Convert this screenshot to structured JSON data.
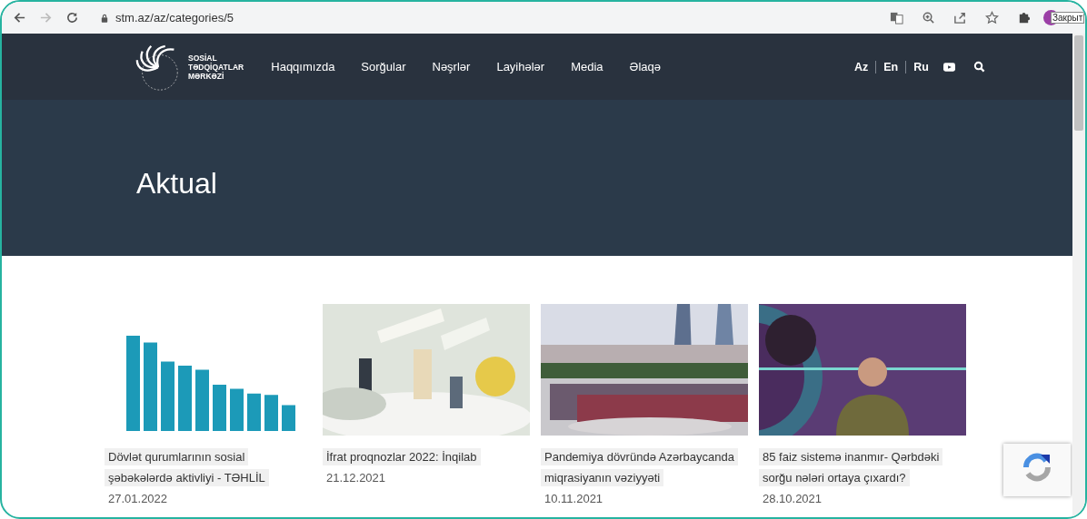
{
  "browser": {
    "url": "stm.az/az/categories/5",
    "tooltip": "Закрыт"
  },
  "header": {
    "logo_lines": [
      "SOSİAL",
      "TƏDQİQATLAR",
      "MƏRKƏZİ"
    ],
    "nav": [
      "Haqqımızda",
      "Sorğular",
      "Nəşrlər",
      "Layihələr",
      "Media",
      "Əlaqə"
    ],
    "languages": [
      "Az",
      "En",
      "Ru"
    ]
  },
  "hero": {
    "title": "Aktual"
  },
  "cards": [
    {
      "kind": "chart",
      "title": "Dövlət qurumlarının sosial şəbəkələrdə aktivliyi - TƏHLİL",
      "date": "27.01.2022"
    },
    {
      "kind": "cartoon",
      "title": "İfrat proqnozlar 2022: İnqilab",
      "date": "21.12.2021"
    },
    {
      "kind": "crowd",
      "title": "Pandemiya dövründə Azərbaycanda miqrasiyanın vəziyyəti",
      "date": "10.11.2021"
    },
    {
      "kind": "studio",
      "title": "85 faiz sistemə inanmır- Qərbdəki sorğu nələri ortaya çıxardı?",
      "date": "28.10.2021"
    }
  ]
}
